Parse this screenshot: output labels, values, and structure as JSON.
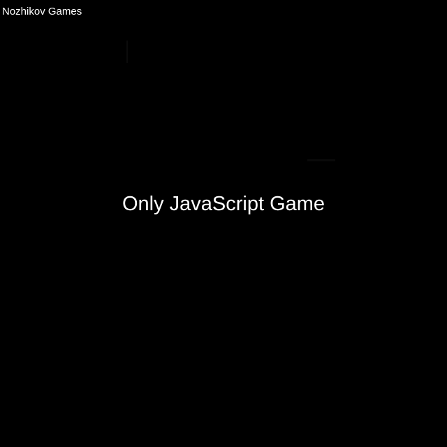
{
  "brand": {
    "label": "Nozhikov Games"
  },
  "splash": {
    "title": "Only JavaScript Game"
  },
  "colors": {
    "background": "#000000",
    "text": "#ffffff"
  }
}
